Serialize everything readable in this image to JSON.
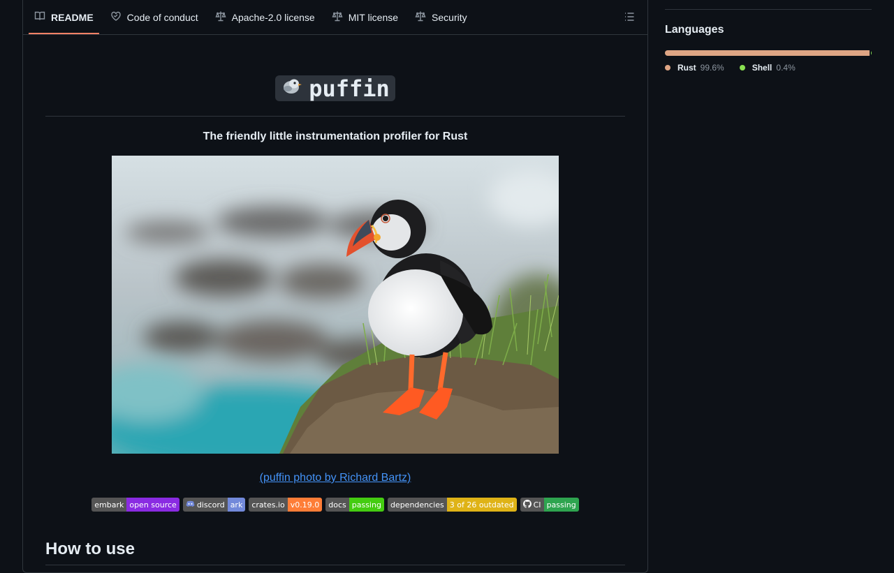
{
  "tabs": [
    {
      "label": "README",
      "icon": "book-icon",
      "active": true
    },
    {
      "label": "Code of conduct",
      "icon": "heart-icon"
    },
    {
      "label": "Apache-2.0 license",
      "icon": "law-icon"
    },
    {
      "label": "MIT license",
      "icon": "law-icon"
    },
    {
      "label": "Security",
      "icon": "law-icon"
    }
  ],
  "readme": {
    "title": "puffin",
    "title_emoji_icon": "bird-icon",
    "tagline": "The friendly little instrumentation profiler for Rust",
    "photo_caption": "(puffin photo by Richard Bartz)",
    "badges": [
      {
        "left": "embark",
        "right": "open source",
        "color": "#8a2be2"
      },
      {
        "left": "discord",
        "right": "ark",
        "color": "#7289da",
        "icon": "discord-icon"
      },
      {
        "left": "crates.io",
        "right": "v0.19.0",
        "color": "#fe7d37"
      },
      {
        "left": "docs",
        "right": "passing",
        "color": "#4c1"
      },
      {
        "left": "dependencies",
        "right": "3 of 26 outdated",
        "color": "#dfb317"
      },
      {
        "left": "CI",
        "right": "passing",
        "color": "#2ea44f",
        "icon": "github-icon"
      }
    ],
    "section_heading": "How to use"
  },
  "sidebar": {
    "languages_title": "Languages",
    "languages": [
      {
        "name": "Rust",
        "percent": "99.6%",
        "value": 99.6,
        "color": "#dea584"
      },
      {
        "name": "Shell",
        "percent": "0.4%",
        "value": 0.4,
        "color": "#89e051"
      }
    ]
  }
}
